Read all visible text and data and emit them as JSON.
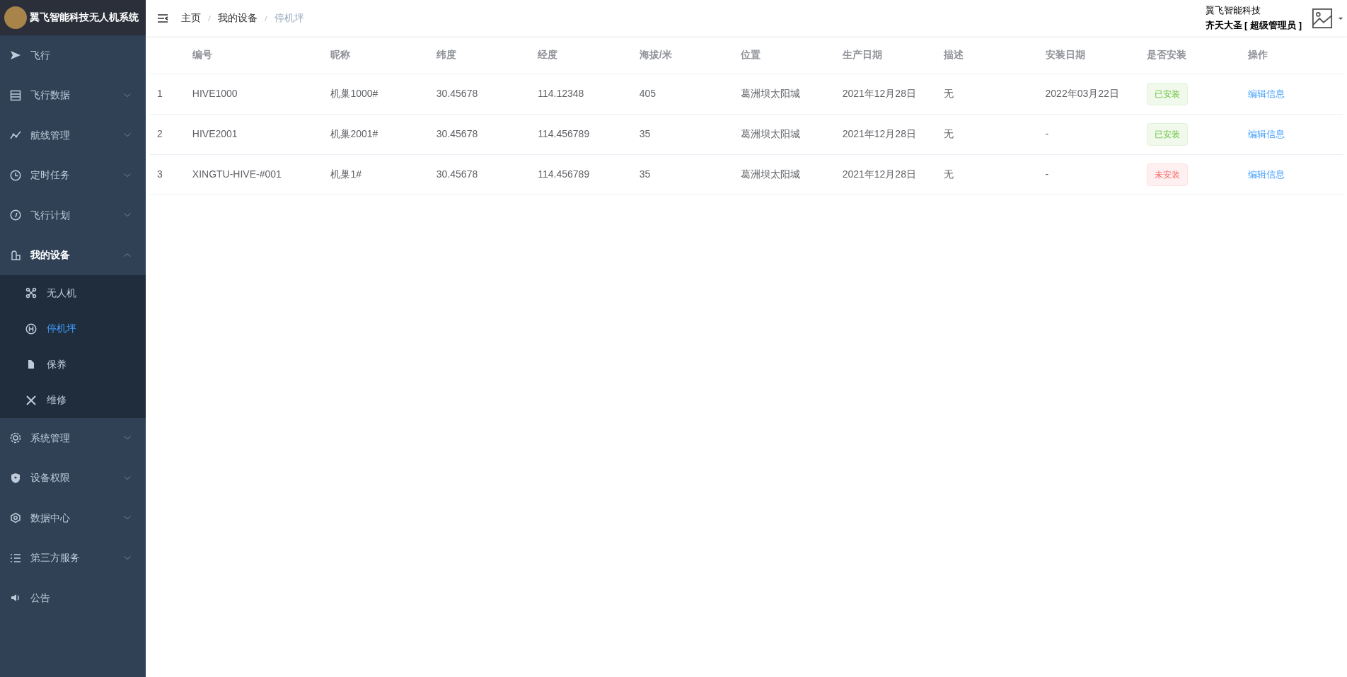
{
  "sidebar": {
    "title": "翼飞智能科技无人机系统",
    "items": [
      {
        "label": "飞行",
        "expandable": false,
        "expanded": false
      },
      {
        "label": "飞行数据",
        "expandable": true,
        "expanded": false
      },
      {
        "label": "航线管理",
        "expandable": true,
        "expanded": false
      },
      {
        "label": "定时任务",
        "expandable": true,
        "expanded": false
      },
      {
        "label": "飞行计划",
        "expandable": true,
        "expanded": false
      },
      {
        "label": "我的设备",
        "expandable": true,
        "expanded": true,
        "children": [
          {
            "label": "无人机",
            "selected": false
          },
          {
            "label": "停机坪",
            "selected": true
          },
          {
            "label": "保养",
            "selected": false
          },
          {
            "label": "维修",
            "selected": false
          }
        ]
      },
      {
        "label": "系统管理",
        "expandable": true,
        "expanded": false
      },
      {
        "label": "设备权限",
        "expandable": true,
        "expanded": false
      },
      {
        "label": "数据中心",
        "expandable": true,
        "expanded": false
      },
      {
        "label": "第三方服务",
        "expandable": true,
        "expanded": false
      },
      {
        "label": "公告",
        "expandable": false,
        "expanded": false
      }
    ]
  },
  "breadcrumb": [
    "主页",
    "我的设备",
    "停机坪"
  ],
  "user": {
    "company": "翼飞智能科技",
    "name": "齐天大圣 [ 超级管理员 ]"
  },
  "table": {
    "columns": [
      "",
      "编号",
      "昵称",
      "纬度",
      "经度",
      "海拔/米",
      "位置",
      "生产日期",
      "描述",
      "安装日期",
      "是否安装",
      "操作"
    ],
    "rows": [
      {
        "cells": [
          "1",
          "HIVE1000",
          "机巢1000#",
          "30.45678",
          "114.12348",
          "405",
          "葛洲坝太阳城",
          "2021年12月28日",
          "无",
          "2022年03月22日"
        ],
        "status": {
          "label": "已安装",
          "installed": true
        },
        "action": "编辑信息"
      },
      {
        "cells": [
          "2",
          "HIVE2001",
          "机巢2001#",
          "30.45678",
          "114.456789",
          "35",
          "葛洲坝太阳城",
          "2021年12月28日",
          "无",
          "-"
        ],
        "status": {
          "label": "已安装",
          "installed": true
        },
        "action": "编辑信息"
      },
      {
        "cells": [
          "3",
          "XINGTU-HIVE-#001",
          "机巢1#",
          "30.45678",
          "114.456789",
          "35",
          "葛洲坝太阳城",
          "2021年12月28日",
          "无",
          "-"
        ],
        "status": {
          "label": "未安装",
          "installed": false
        },
        "action": "编辑信息"
      }
    ]
  }
}
